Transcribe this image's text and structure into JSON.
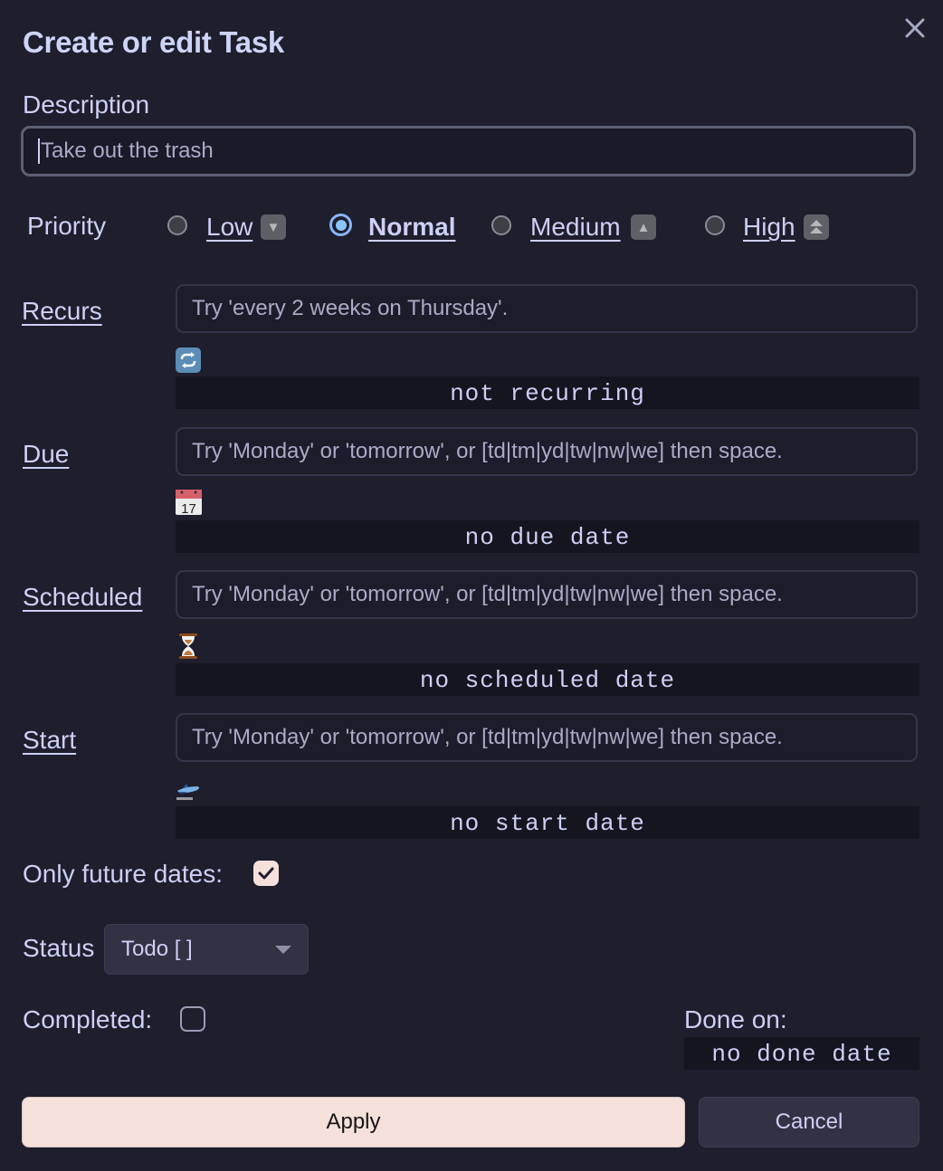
{
  "dialog": {
    "title": "Create or edit Task",
    "close_icon": "close-icon"
  },
  "description": {
    "label": "Description",
    "value": "Take out the trash"
  },
  "priority": {
    "label": "Priority",
    "selected": "Normal",
    "options": [
      {
        "label": "Low",
        "icon": "down-triangle-badge-icon",
        "glyph": "▼",
        "checked": false
      },
      {
        "label": "Normal",
        "icon": "",
        "glyph": "",
        "checked": true
      },
      {
        "label": "Medium",
        "icon": "up-triangle-badge-icon",
        "glyph": "▲",
        "checked": false
      },
      {
        "label": "High",
        "icon": "double-up-triangle-badge-icon",
        "glyph": "⏫",
        "checked": false
      }
    ]
  },
  "recurs": {
    "label": "Recurs",
    "placeholder": "Try 'every 2 weeks on Thursday'.",
    "icon": "repeat-icon",
    "summary": "not recurring"
  },
  "due": {
    "label": "Due",
    "placeholder": "Try 'Monday' or 'tomorrow', or [td|tm|yd|tw|nw|we] then space.",
    "icon": "calendar-icon",
    "icon_text": "17",
    "summary": "no due date"
  },
  "scheduled": {
    "label": "Scheduled",
    "placeholder": "Try 'Monday' or 'tomorrow', or [td|tm|yd|tw|nw|we] then space.",
    "icon": "hourglass-icon",
    "summary": "no scheduled date"
  },
  "start": {
    "label": "Start",
    "placeholder": "Try 'Monday' or 'tomorrow', or [td|tm|yd|tw|nw|we] then space.",
    "icon": "airplane-departure-icon",
    "summary": "no start date"
  },
  "only_future_dates": {
    "label": "Only future dates:",
    "checked": true
  },
  "status": {
    "label": "Status",
    "selected": "Todo [ ]"
  },
  "completed": {
    "label": "Completed:",
    "checked": false
  },
  "done_on": {
    "label": "Done on:",
    "value": "no done date"
  },
  "buttons": {
    "apply": "Apply",
    "cancel": "Cancel"
  },
  "colors": {
    "background": "#1e1e2d",
    "text": "#cdd0f5",
    "accent": "#89b4fa",
    "apply_button": "#f5e0dc",
    "secondary_button": "#313244"
  }
}
